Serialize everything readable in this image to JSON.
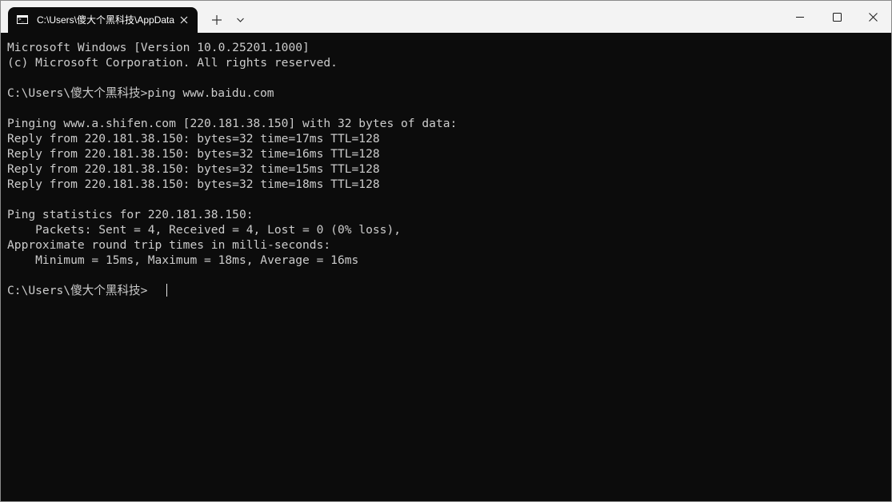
{
  "window": {
    "tab_title": "C:\\Users\\傻大个黑科技\\AppData",
    "tab_icon": "command-prompt-icon",
    "tab_icon_text": ">_",
    "new_tab_icon": "plus-icon",
    "dropdown_icon": "chevron-down-icon",
    "controls": [
      "minimize-icon",
      "maximize-icon",
      "close-icon"
    ]
  },
  "terminal": {
    "text_color": "#cccccc",
    "background": "#0c0c0c",
    "lines": [
      "Microsoft Windows [Version 10.0.25201.1000]",
      "(c) Microsoft Corporation. All rights reserved.",
      "",
      "C:\\Users\\傻大个黑科技>ping www.baidu.com",
      "",
      "Pinging www.a.shifen.com [220.181.38.150] with 32 bytes of data:",
      "Reply from 220.181.38.150: bytes=32 time=17ms TTL=128",
      "Reply from 220.181.38.150: bytes=32 time=16ms TTL=128",
      "Reply from 220.181.38.150: bytes=32 time=15ms TTL=128",
      "Reply from 220.181.38.150: bytes=32 time=18ms TTL=128",
      "",
      "Ping statistics for 220.181.38.150:",
      "    Packets: Sent = 4, Received = 4, Lost = 0 (0% loss),",
      "Approximate round trip times in milli-seconds:",
      "    Minimum = 15ms, Maximum = 18ms, Average = 16ms",
      "",
      "C:\\Users\\傻大个黑科技>"
    ]
  }
}
